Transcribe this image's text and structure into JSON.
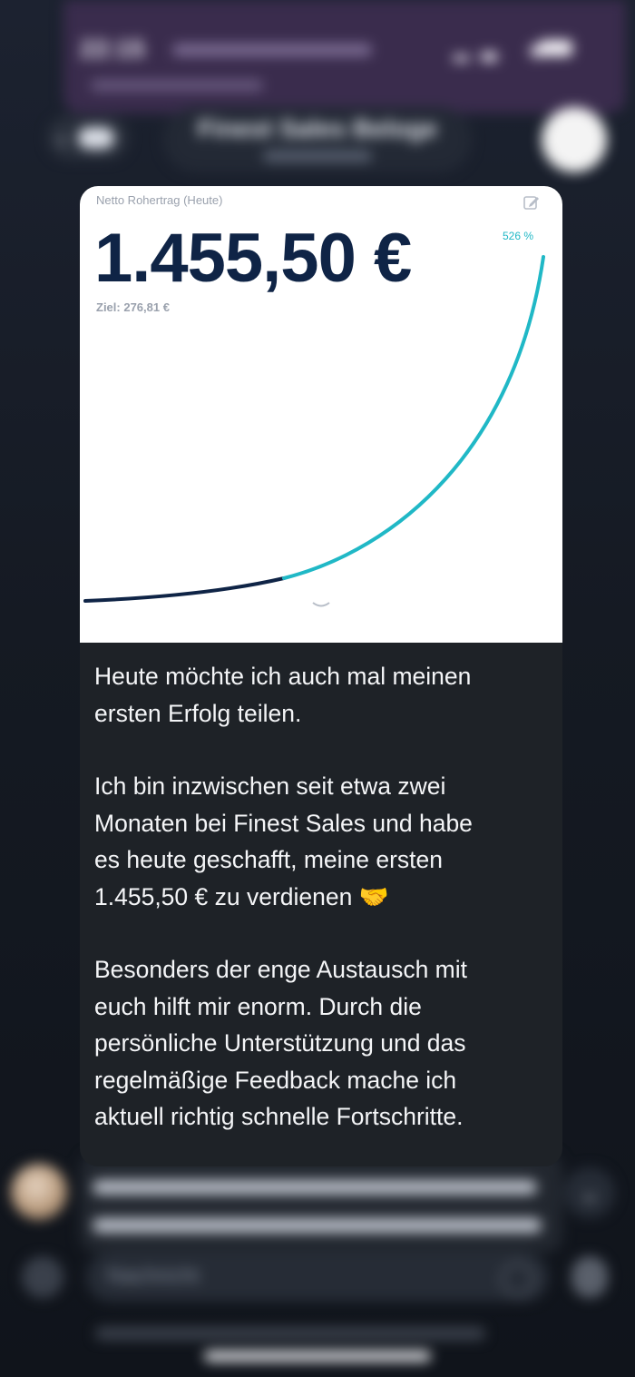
{
  "status_bar": {
    "time": "22:15"
  },
  "header": {
    "chat_title": "Finest Sales Beloge",
    "back_icon": "chevron-left-icon",
    "avatar_icon": "group-avatar"
  },
  "message": {
    "image": {
      "label": "Netto Rohertrag (Heute)",
      "amount": "1.455,50 €",
      "goal": "Ziel: 276,81 €",
      "percent": "526 %",
      "progress_fraction": 5.26,
      "colors": {
        "amount": "#0f2446",
        "line_dark": "#0f2446",
        "line_accent": "#20b8c6"
      }
    },
    "paragraphs": [
      "Heute möchte ich auch mal meinen\nersten Erfolg teilen.",
      "Ich bin inzwischen seit etwa zwei\nMonaten bei Finest Sales und habe\nes heute geschafft, meine ersten\n1.455,50 € zu verdienen 🤝",
      "Besonders der enge Austausch mit\neuch hilft mir enorm. Durch die\npersönliche Unterstützung und das\nregelmäßige Feedback mache ich\naktuell richtig schnelle Fortschritte."
    ]
  },
  "composer": {
    "placeholder": "Nachricht"
  }
}
